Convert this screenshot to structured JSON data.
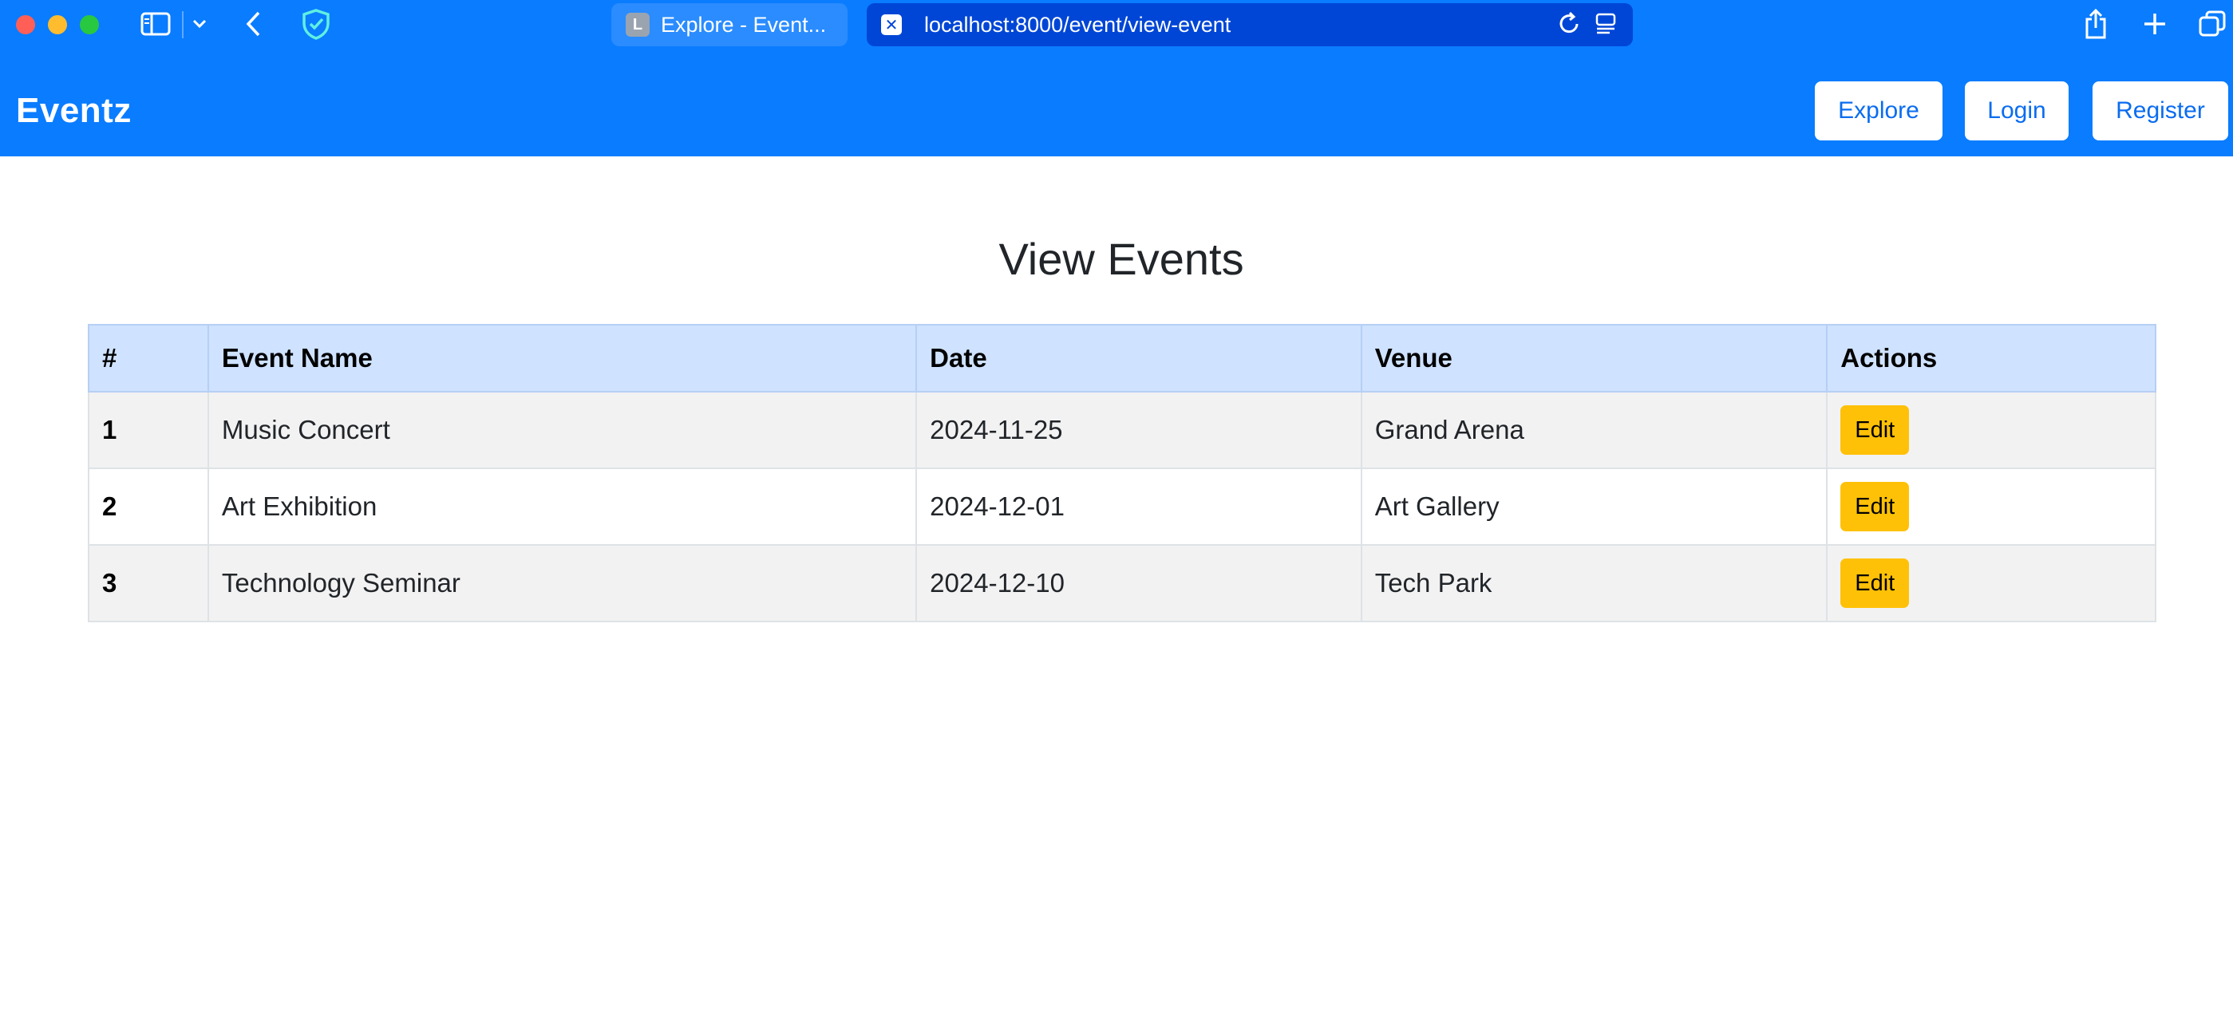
{
  "browser": {
    "inactive_tab": {
      "favicon_letter": "L",
      "title": "Explore - Event..."
    },
    "active_tab": {
      "favicon_letter": "✕",
      "url": "localhost:8000/event/view-event"
    }
  },
  "navbar": {
    "brand": "Eventz",
    "links": {
      "explore": "Explore",
      "login": "Login",
      "register": "Register"
    }
  },
  "main": {
    "title": "View Events",
    "table": {
      "headers": [
        "#",
        "Event Name",
        "Date",
        "Venue",
        "Actions"
      ],
      "rows": [
        {
          "num": "1",
          "name": "Music Concert",
          "date": "2024-11-25",
          "venue": "Grand Arena",
          "action": "Edit"
        },
        {
          "num": "2",
          "name": "Art Exhibition",
          "date": "2024-12-01",
          "venue": "Art Gallery",
          "action": "Edit"
        },
        {
          "num": "3",
          "name": "Technology Seminar",
          "date": "2024-12-10",
          "venue": "Tech Park",
          "action": "Edit"
        }
      ]
    }
  },
  "colors": {
    "primary": "#0a7cff",
    "table_header": "#cfe2ff",
    "edit_button": "#ffc107",
    "row_stripe": "#f2f2f2"
  },
  "icons": [
    "sidebar-icon",
    "chevron-down-icon",
    "back-icon",
    "shield-icon",
    "reload-icon",
    "reader-icon",
    "share-icon",
    "plus-icon",
    "tabs-overview-icon"
  ]
}
